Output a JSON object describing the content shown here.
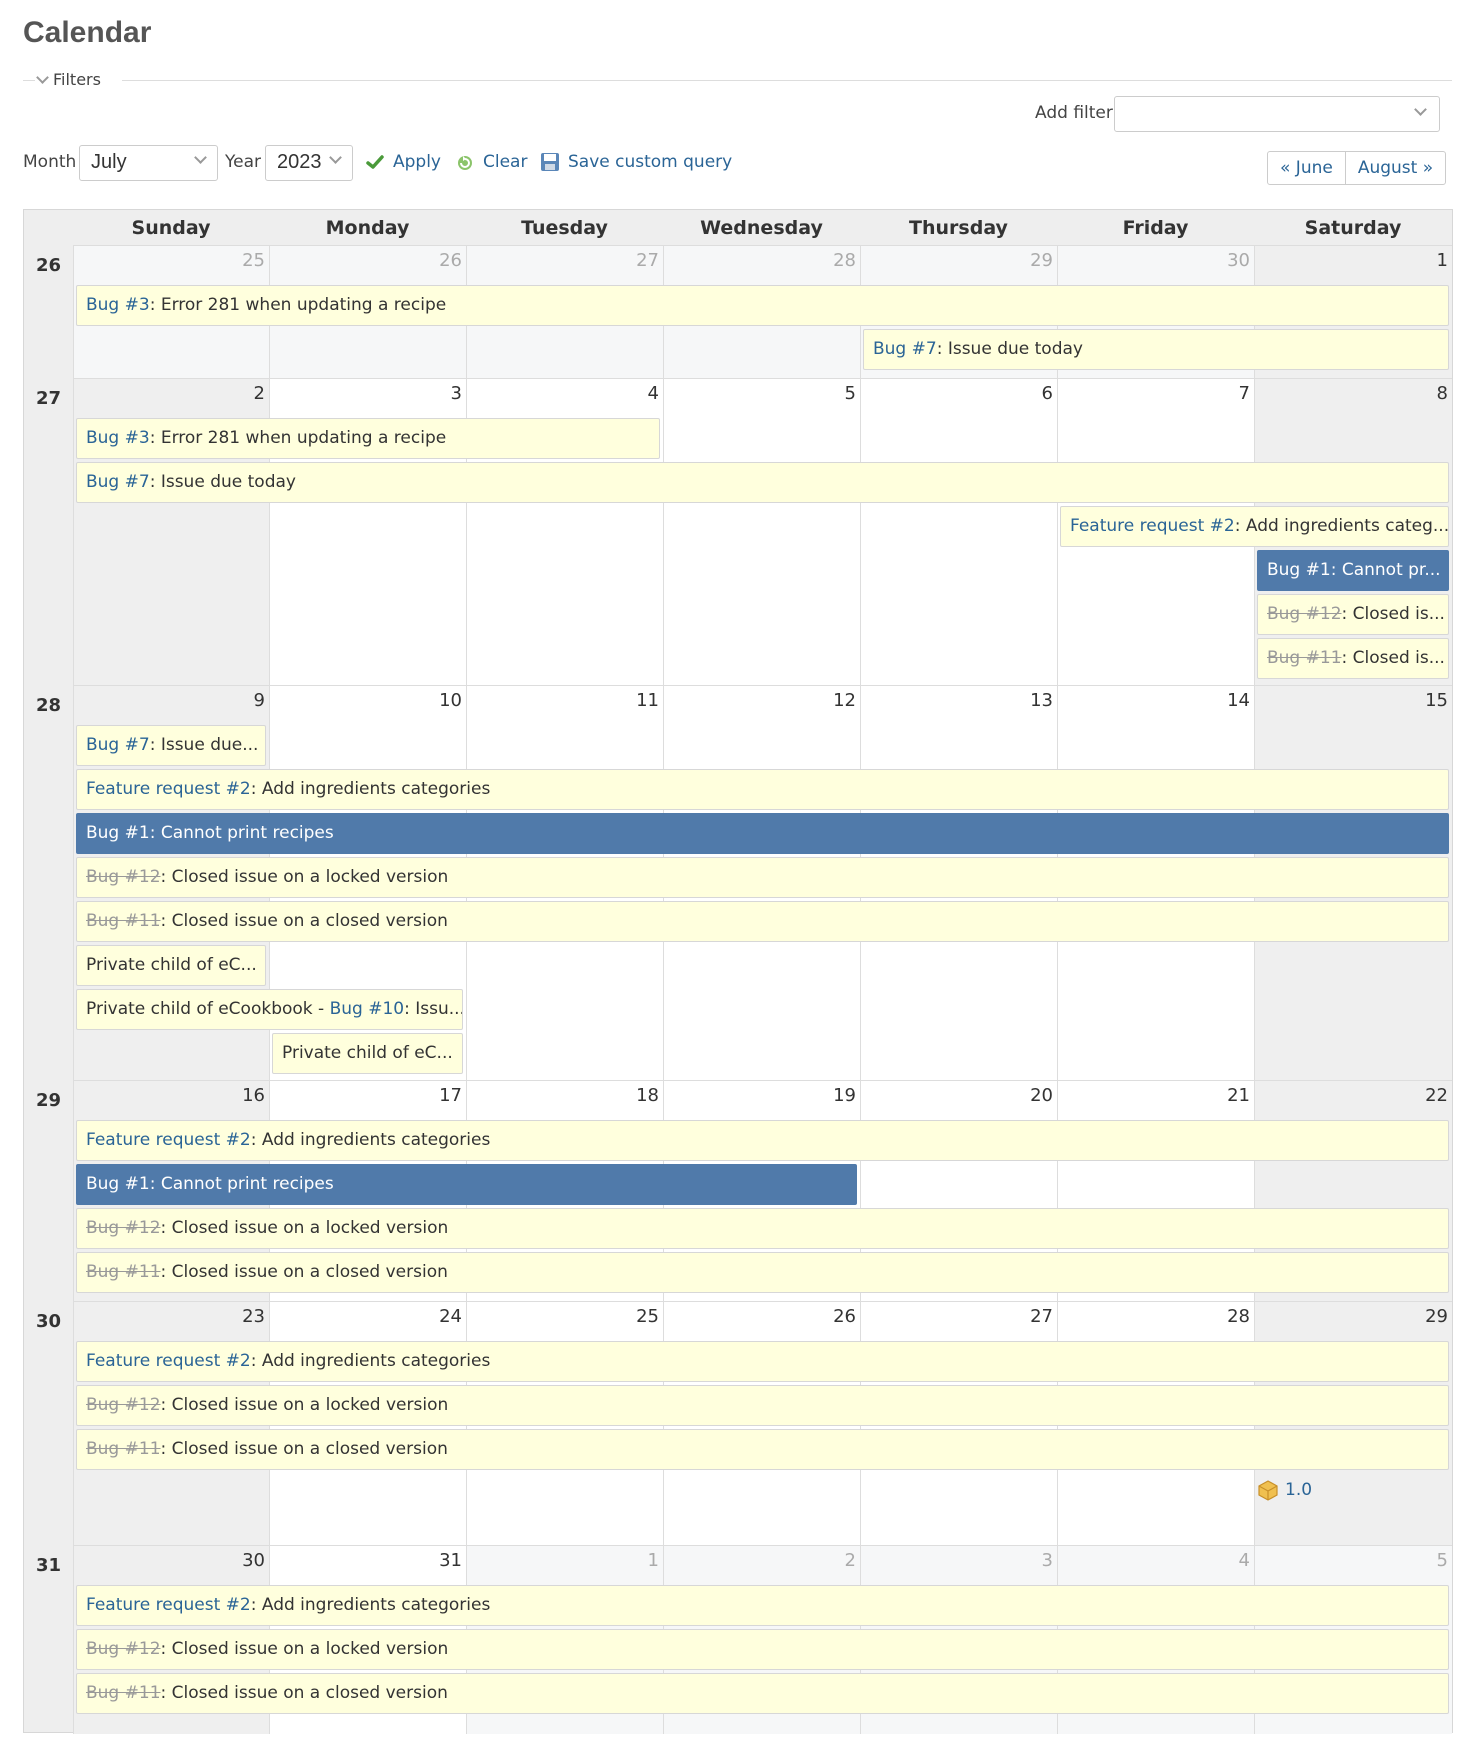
{
  "page": {
    "title": "Calendar"
  },
  "filters": {
    "legend": "Filters",
    "add_filter_label": "Add filter",
    "add_filter_value": ""
  },
  "controls": {
    "month_label": "Month",
    "month_value": "July",
    "year_label": "Year",
    "year_value": "2023",
    "apply": "Apply",
    "clear": "Clear",
    "save": "Save custom query",
    "prev": "« June",
    "next": "August »"
  },
  "calendar": {
    "days": [
      "Sunday",
      "Monday",
      "Tuesday",
      "Wednesday",
      "Thursday",
      "Friday",
      "Saturday"
    ],
    "weeks": [
      {
        "num": "26",
        "dates": [
          "25",
          "26",
          "27",
          "28",
          "29",
          "30",
          "1"
        ]
      },
      {
        "num": "27",
        "dates": [
          "2",
          "3",
          "4",
          "5",
          "6",
          "7",
          "8"
        ]
      },
      {
        "num": "28",
        "dates": [
          "9",
          "10",
          "11",
          "12",
          "13",
          "14",
          "15"
        ]
      },
      {
        "num": "29",
        "dates": [
          "16",
          "17",
          "18",
          "19",
          "20",
          "21",
          "22"
        ]
      },
      {
        "num": "30",
        "dates": [
          "23",
          "24",
          "25",
          "26",
          "27",
          "28",
          "29"
        ]
      },
      {
        "num": "31",
        "dates": [
          "30",
          "31",
          "1",
          "2",
          "3",
          "4",
          "5"
        ]
      }
    ],
    "events": [
      {
        "week": 0,
        "start": 0,
        "span": 7,
        "row": 0,
        "link": "Bug #3",
        "text": ": Error 281 when updating a recipe"
      },
      {
        "week": 0,
        "start": 4,
        "span": 3,
        "row": 1,
        "link": "Bug #7",
        "text": ": Issue due today"
      },
      {
        "week": 1,
        "start": 0,
        "span": 3,
        "row": 0,
        "link": "Bug #3",
        "text": ": Error 281 when updating a recipe"
      },
      {
        "week": 1,
        "start": 0,
        "span": 7,
        "row": 1,
        "link": "Bug #7",
        "text": ": Issue due today"
      },
      {
        "week": 1,
        "start": 5,
        "span": 2,
        "row": 2,
        "link": "Feature request #2",
        "text": ": Add ingredients categ..."
      },
      {
        "week": 1,
        "start": 6,
        "span": 1,
        "row": 3,
        "link": "Bug #1",
        "text": ": Cannot pr...",
        "style": "blue"
      },
      {
        "week": 1,
        "start": 6,
        "span": 1,
        "row": 4,
        "link": "Bug #12",
        "text": ": Closed is...",
        "style": "closed"
      },
      {
        "week": 1,
        "start": 6,
        "span": 1,
        "row": 5,
        "link": "Bug #11",
        "text": ": Closed is...",
        "style": "closed"
      },
      {
        "week": 2,
        "start": 0,
        "span": 1,
        "row": 0,
        "link": "Bug #7",
        "text": ": Issue due..."
      },
      {
        "week": 2,
        "start": 0,
        "span": 7,
        "row": 1,
        "link": "Feature request #2",
        "text": ": Add ingredients categories"
      },
      {
        "week": 2,
        "start": 0,
        "span": 7,
        "row": 2,
        "link": "Bug #1",
        "text": ": Cannot print recipes",
        "style": "blue"
      },
      {
        "week": 2,
        "start": 0,
        "span": 7,
        "row": 3,
        "link": "Bug #12",
        "text": ": Closed issue on a locked version",
        "style": "closed"
      },
      {
        "week": 2,
        "start": 0,
        "span": 7,
        "row": 4,
        "link": "Bug #11",
        "text": ": Closed issue on a closed version",
        "style": "closed"
      },
      {
        "week": 2,
        "start": 0,
        "span": 1,
        "row": 5,
        "prefix": "Private child of eC..."
      },
      {
        "week": 2,
        "start": 0,
        "span": 2,
        "row": 6,
        "prefix": "Private child of eCookbook - ",
        "link": "Bug #10",
        "text": ": Issu..."
      },
      {
        "week": 2,
        "start": 1,
        "span": 1,
        "row": 7,
        "prefix": "Private child of eC..."
      },
      {
        "week": 3,
        "start": 0,
        "span": 7,
        "row": 0,
        "link": "Feature request #2",
        "text": ": Add ingredients categories"
      },
      {
        "week": 3,
        "start": 0,
        "span": 4,
        "row": 1,
        "link": "Bug #1",
        "text": ": Cannot print recipes",
        "style": "blue"
      },
      {
        "week": 3,
        "start": 0,
        "span": 7,
        "row": 2,
        "link": "Bug #12",
        "text": ": Closed issue on a locked version",
        "style": "closed"
      },
      {
        "week": 3,
        "start": 0,
        "span": 7,
        "row": 3,
        "link": "Bug #11",
        "text": ": Closed issue on a closed version",
        "style": "closed"
      },
      {
        "week": 4,
        "start": 0,
        "span": 7,
        "row": 0,
        "link": "Feature request #2",
        "text": ": Add ingredients categories"
      },
      {
        "week": 4,
        "start": 0,
        "span": 7,
        "row": 1,
        "link": "Bug #12",
        "text": ": Closed issue on a locked version",
        "style": "closed"
      },
      {
        "week": 4,
        "start": 0,
        "span": 7,
        "row": 2,
        "link": "Bug #11",
        "text": ": Closed issue on a closed version",
        "style": "closed"
      },
      {
        "week": 5,
        "start": 0,
        "span": 7,
        "row": 0,
        "link": "Feature request #2",
        "text": ": Add ingredients categories"
      },
      {
        "week": 5,
        "start": 0,
        "span": 7,
        "row": 1,
        "link": "Bug #12",
        "text": ": Closed issue on a locked version",
        "style": "closed"
      },
      {
        "week": 5,
        "start": 0,
        "span": 7,
        "row": 2,
        "link": "Bug #11",
        "text": ": Closed issue on a closed version",
        "style": "closed"
      }
    ],
    "versions": [
      {
        "week": 4,
        "day": 6,
        "row": 3,
        "label": "1.0",
        "icon": "package-icon"
      }
    ]
  }
}
